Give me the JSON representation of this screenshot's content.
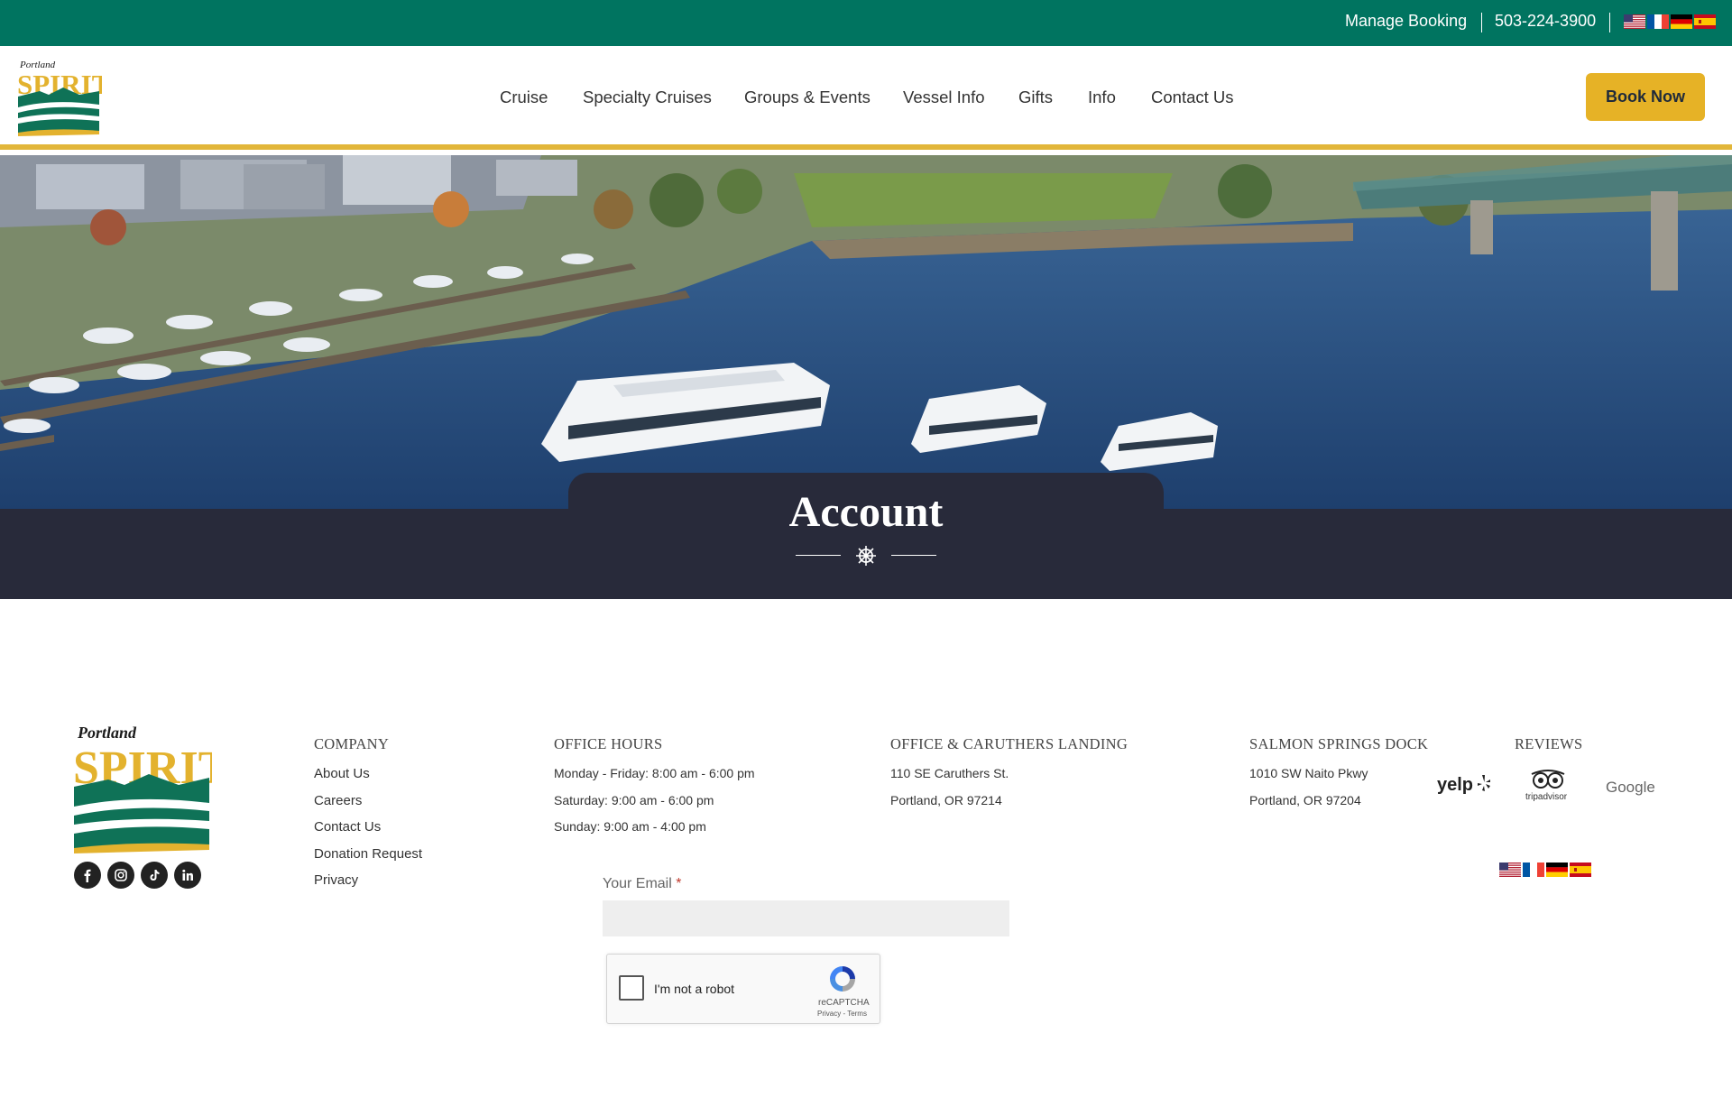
{
  "topbar": {
    "manage_booking": "Manage Booking",
    "phone": "503-224-3900",
    "flags": [
      "us-flag",
      "fr-flag",
      "de-flag",
      "es-flag"
    ]
  },
  "header": {
    "logo_text_top": "Portland",
    "logo_text_main": "SPIRIT",
    "nav": [
      "Cruise",
      "Specialty Cruises",
      "Groups & Events",
      "Vessel Info",
      "Gifts",
      "Info",
      "Contact Us"
    ],
    "book_now": "Book Now"
  },
  "hero": {
    "title": "Account",
    "divider_icon": "ship-wheel-icon"
  },
  "footer": {
    "logo_text_top": "Portland",
    "logo_text_main": "SPIRIT",
    "social": [
      "facebook-icon",
      "instagram-icon",
      "tiktok-icon",
      "linkedin-icon"
    ],
    "company": {
      "heading": "COMPANY",
      "links": [
        "About Us",
        "Careers",
        "Contact Us",
        "Donation Request",
        "Privacy"
      ]
    },
    "office_hours": {
      "heading": "OFFICE HOURS",
      "lines": [
        "Monday - Friday: 8:00 am - 6:00 pm",
        "Saturday: 9:00 am - 6:00 pm",
        "Sunday: 9:00 am - 4:00 pm"
      ]
    },
    "office_landing": {
      "heading": "OFFICE & CARUTHERS LANDING",
      "lines": [
        "110 SE Caruthers St.",
        "Portland, OR 97214"
      ]
    },
    "salmon_dock": {
      "heading": "SALMON SPRINGS DOCK",
      "lines": [
        "1010 SW Naito Pkwy",
        "Portland, OR 97204"
      ]
    },
    "reviews": {
      "heading": "REVIEWS",
      "yelp": "yelp",
      "tripadvisor": "tripadvisor",
      "google": "Google"
    }
  },
  "form": {
    "email_label": "Your Email",
    "required_mark": "*",
    "email_value": "",
    "recaptcha_label": "I'm not a robot",
    "recaptcha_brand": "reCAPTCHA",
    "recaptcha_terms": "Privacy - Terms"
  },
  "colors": {
    "topbar": "#007460",
    "accent": "#e2b63a",
    "book_button": "#e6b226",
    "band": "#282a3a"
  }
}
